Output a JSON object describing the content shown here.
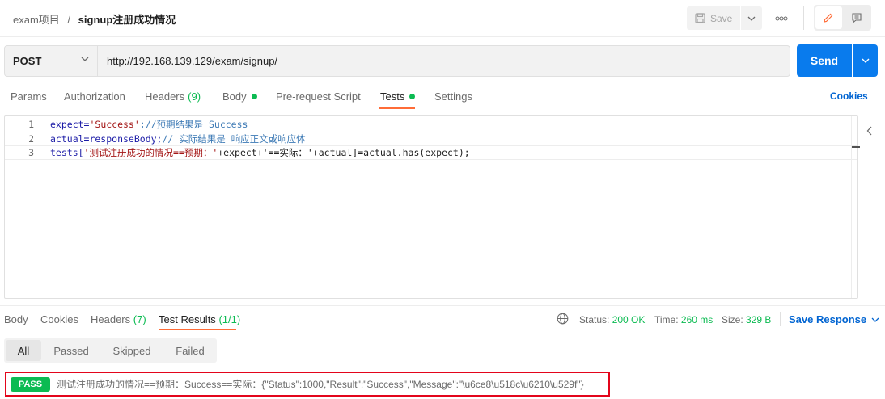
{
  "header": {
    "collection": "exam项目",
    "separator": "/",
    "request_name": "signup注册成功情况",
    "save_label": "Save",
    "more_icon": "more-horizontal-icon",
    "edit_icon": "pencil-icon",
    "comment_icon": "comment-icon"
  },
  "request": {
    "method": "POST",
    "url": "http://192.168.139.129/exam/signup/",
    "send_label": "Send"
  },
  "req_tabs": {
    "params": "Params",
    "authorization": "Authorization",
    "headers": "Headers",
    "headers_count": "(9)",
    "body": "Body",
    "prerequest": "Pre-request Script",
    "tests": "Tests",
    "settings": "Settings",
    "cookies": "Cookies"
  },
  "editor": {
    "lines": [
      {
        "n": "1",
        "a": "expect=",
        "b": "'Success'",
        "c": ";//预期结果是 Success"
      },
      {
        "n": "2",
        "a": "actual=responseBody;",
        "b": "",
        "c": "// 实际结果是 响应正文或响应体"
      },
      {
        "n": "3",
        "a": "tests[",
        "b": "'测试注册成功的情况==预期：'",
        "c": "+expect+'==实际：'+actual]=actual.has(expect);"
      }
    ]
  },
  "response": {
    "tabs": {
      "body": "Body",
      "cookies": "Cookies",
      "headers": "Headers",
      "headers_count": "(7)",
      "test_results": "Test Results",
      "test_results_count": "(1/1)"
    },
    "status_label": "Status:",
    "status_value": "200 OK",
    "time_label": "Time:",
    "time_value": "260 ms",
    "size_label": "Size:",
    "size_value": "329 B",
    "save_response": "Save Response",
    "filters": [
      "All",
      "Passed",
      "Skipped",
      "Failed"
    ],
    "result_badge": "PASS",
    "result_text": "测试注册成功的情况==预期：Success==实际：{\"Status\":1000,\"Result\":\"Success\",\"Message\":\"\\u6ce8\\u518c\\u6210\\u529f\"}"
  },
  "colors": {
    "accent_orange": "#ff6c37",
    "send_blue": "#097bed",
    "link_blue": "#0265d2",
    "pass_green": "#0cbb52",
    "highlight_red": "#e3051b"
  }
}
